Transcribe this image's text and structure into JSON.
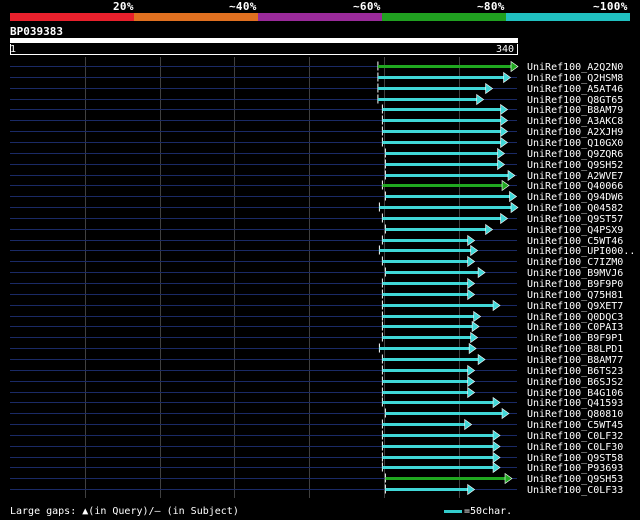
{
  "legend": {
    "labels": [
      "20%",
      "~40%",
      "~60%",
      "~80%",
      "~100%"
    ],
    "colors": [
      "#e8202c",
      "#e07020",
      "#9a2a9a",
      "#20a020",
      "#20c0c0"
    ]
  },
  "query": {
    "id": "BP039383",
    "start": "1",
    "end": "340",
    "length": 340
  },
  "plot_colors": {
    "guide": "#1a2a66",
    "grid": "#404040",
    "cyan": "#40d8d8",
    "green": "#20a820"
  },
  "hits": [
    {
      "name": "UniRef100_A2Q2N0",
      "start": 247,
      "end": 340,
      "color": "green"
    },
    {
      "name": "UniRef100_Q2HSM8",
      "start": 247,
      "end": 335,
      "color": "cyan"
    },
    {
      "name": "UniRef100_A5AT46",
      "start": 247,
      "end": 323,
      "color": "cyan"
    },
    {
      "name": "UniRef100_Q8GT65",
      "start": 247,
      "end": 317,
      "color": "cyan"
    },
    {
      "name": "UniRef100_B8AM79",
      "start": 250,
      "end": 333,
      "color": "cyan"
    },
    {
      "name": "UniRef100_A3AKC8",
      "start": 250,
      "end": 333,
      "color": "cyan"
    },
    {
      "name": "UniRef100_A2XJH9",
      "start": 250,
      "end": 333,
      "color": "cyan"
    },
    {
      "name": "UniRef100_Q10GX0",
      "start": 250,
      "end": 333,
      "color": "cyan"
    },
    {
      "name": "UniRef100_Q9ZQR6",
      "start": 252,
      "end": 331,
      "color": "cyan"
    },
    {
      "name": "UniRef100_Q9SH52",
      "start": 252,
      "end": 331,
      "color": "cyan"
    },
    {
      "name": "UniRef100_A2WVE7",
      "start": 252,
      "end": 338,
      "color": "cyan"
    },
    {
      "name": "UniRef100_Q40066",
      "start": 250,
      "end": 334,
      "color": "green"
    },
    {
      "name": "UniRef100_Q94DW6",
      "start": 252,
      "end": 339,
      "color": "cyan"
    },
    {
      "name": "UniRef100_Q04582",
      "start": 248,
      "end": 340,
      "color": "cyan"
    },
    {
      "name": "UniRef100_Q9ST57",
      "start": 250,
      "end": 333,
      "color": "cyan"
    },
    {
      "name": "UniRef100_Q4PSX9",
      "start": 252,
      "end": 323,
      "color": "cyan"
    },
    {
      "name": "UniRef100_C5WT46",
      "start": 250,
      "end": 311,
      "color": "cyan"
    },
    {
      "name": "UniRef100_UPI000..",
      "start": 248,
      "end": 313,
      "color": "cyan"
    },
    {
      "name": "UniRef100_C7IZM0",
      "start": 250,
      "end": 311,
      "color": "cyan"
    },
    {
      "name": "UniRef100_B9MVJ6",
      "start": 252,
      "end": 318,
      "color": "cyan"
    },
    {
      "name": "UniRef100_B9F9P0",
      "start": 250,
      "end": 311,
      "color": "cyan"
    },
    {
      "name": "UniRef100_Q75H81",
      "start": 250,
      "end": 311,
      "color": "cyan"
    },
    {
      "name": "UniRef100_Q9XET7",
      "start": 250,
      "end": 328,
      "color": "cyan"
    },
    {
      "name": "UniRef100_Q0DQC3",
      "start": 250,
      "end": 315,
      "color": "cyan"
    },
    {
      "name": "UniRef100_C0PAI3",
      "start": 250,
      "end": 314,
      "color": "cyan"
    },
    {
      "name": "UniRef100_B9F9P1",
      "start": 250,
      "end": 313,
      "color": "cyan"
    },
    {
      "name": "UniRef100_B8LPD1",
      "start": 248,
      "end": 312,
      "color": "cyan"
    },
    {
      "name": "UniRef100_B8AM77",
      "start": 250,
      "end": 318,
      "color": "cyan"
    },
    {
      "name": "UniRef100_B6TS23",
      "start": 250,
      "end": 311,
      "color": "cyan"
    },
    {
      "name": "UniRef100_B6SJS2",
      "start": 250,
      "end": 311,
      "color": "cyan"
    },
    {
      "name": "UniRef100_B4G106",
      "start": 250,
      "end": 311,
      "color": "cyan"
    },
    {
      "name": "UniRef100_Q41593",
      "start": 250,
      "end": 328,
      "color": "cyan"
    },
    {
      "name": "UniRef100_Q80810",
      "start": 252,
      "end": 334,
      "color": "cyan"
    },
    {
      "name": "UniRef100_C5WT45",
      "start": 250,
      "end": 309,
      "color": "cyan"
    },
    {
      "name": "UniRef100_C0LF32",
      "start": 250,
      "end": 328,
      "color": "cyan"
    },
    {
      "name": "UniRef100_C0LF30",
      "start": 250,
      "end": 328,
      "color": "cyan"
    },
    {
      "name": "UniRef100_Q9ST58",
      "start": 250,
      "end": 328,
      "color": "cyan"
    },
    {
      "name": "UniRef100_P93693",
      "start": 250,
      "end": 328,
      "color": "cyan"
    },
    {
      "name": "UniRef100_Q9SH53",
      "start": 252,
      "end": 336,
      "color": "green"
    },
    {
      "name": "UniRef100_C0LF33",
      "start": 252,
      "end": 311,
      "color": "cyan"
    }
  ],
  "footer": {
    "gaps_label": "Large gaps:",
    "query_gap_glyph": "▲",
    "query_gap_text": "(in Query)/",
    "subject_gap_glyph": "—",
    "subject_gap_text": "(in Subject)",
    "scale_label": "=50char."
  }
}
